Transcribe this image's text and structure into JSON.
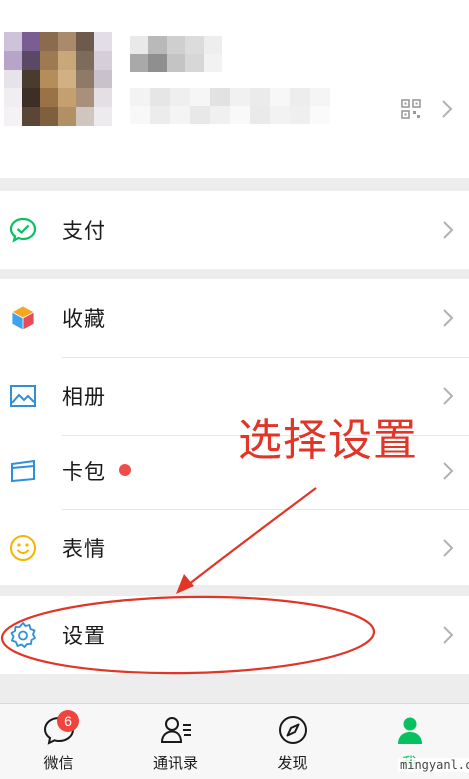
{
  "profile": {
    "qr_icon": "qr-code-icon",
    "chevron_icon": "chevron-right-icon"
  },
  "menu": {
    "pay": {
      "label": "支付",
      "icon": "wechat-pay-icon"
    },
    "favorites": {
      "label": "收藏",
      "icon": "cube-icon"
    },
    "album": {
      "label": "相册",
      "icon": "photo-icon"
    },
    "cards": {
      "label": "卡包",
      "icon": "card-wallet-icon"
    },
    "stickers": {
      "label": "表情",
      "icon": "smiley-icon"
    },
    "settings": {
      "label": "设置",
      "icon": "gear-icon"
    }
  },
  "annotation": {
    "text": "选择设置",
    "color": "#e03527"
  },
  "tabbar": {
    "tabs": [
      {
        "label": "微信",
        "icon": "chat-bubble-icon",
        "badge": "6"
      },
      {
        "label": "通讯录",
        "icon": "contacts-icon"
      },
      {
        "label": "发现",
        "icon": "compass-icon"
      },
      {
        "label": "我",
        "icon": "person-icon",
        "active": true
      }
    ]
  },
  "watermark": "mingyanl.com",
  "colors": {
    "accent_green": "#07c160",
    "badge_red": "#f0453e",
    "dot_red": "#f14c4c",
    "background": "#ededed"
  }
}
